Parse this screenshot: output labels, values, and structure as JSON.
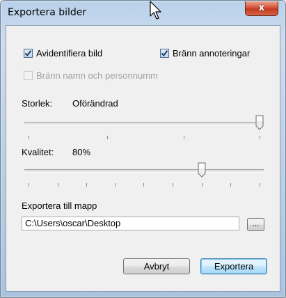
{
  "window": {
    "title": "Exportera bilder",
    "close_label": "x"
  },
  "options": {
    "anonymize_label": "Avidentifiera bild",
    "anonymize_checked": true,
    "burn_annotations_label": "Bränn annoteringar",
    "burn_annotations_checked": true,
    "burn_name_label": "Bränn namn och personnumm",
    "burn_name_checked": false,
    "burn_name_enabled": false
  },
  "size": {
    "label": "Storlek:",
    "value": "Oförändrad",
    "slider_fraction": 1.0
  },
  "quality": {
    "label": "Kvalitet:",
    "value": "80%",
    "slider_fraction": 0.75
  },
  "export_folder": {
    "label": "Exportera till mapp",
    "path": "C:\\Users\\oscar\\Desktop",
    "browse_label": "..."
  },
  "buttons": {
    "cancel_label": "Avbryt",
    "export_label": "Exportera"
  },
  "colors": {
    "close_button": "#c23a1f",
    "default_button_border": "#3c7fb1",
    "titlebar": "#b9d1ea"
  },
  "icons": {
    "close": "close-icon",
    "cursor": "mouse-cursor-icon",
    "check": "checkmark-icon"
  }
}
